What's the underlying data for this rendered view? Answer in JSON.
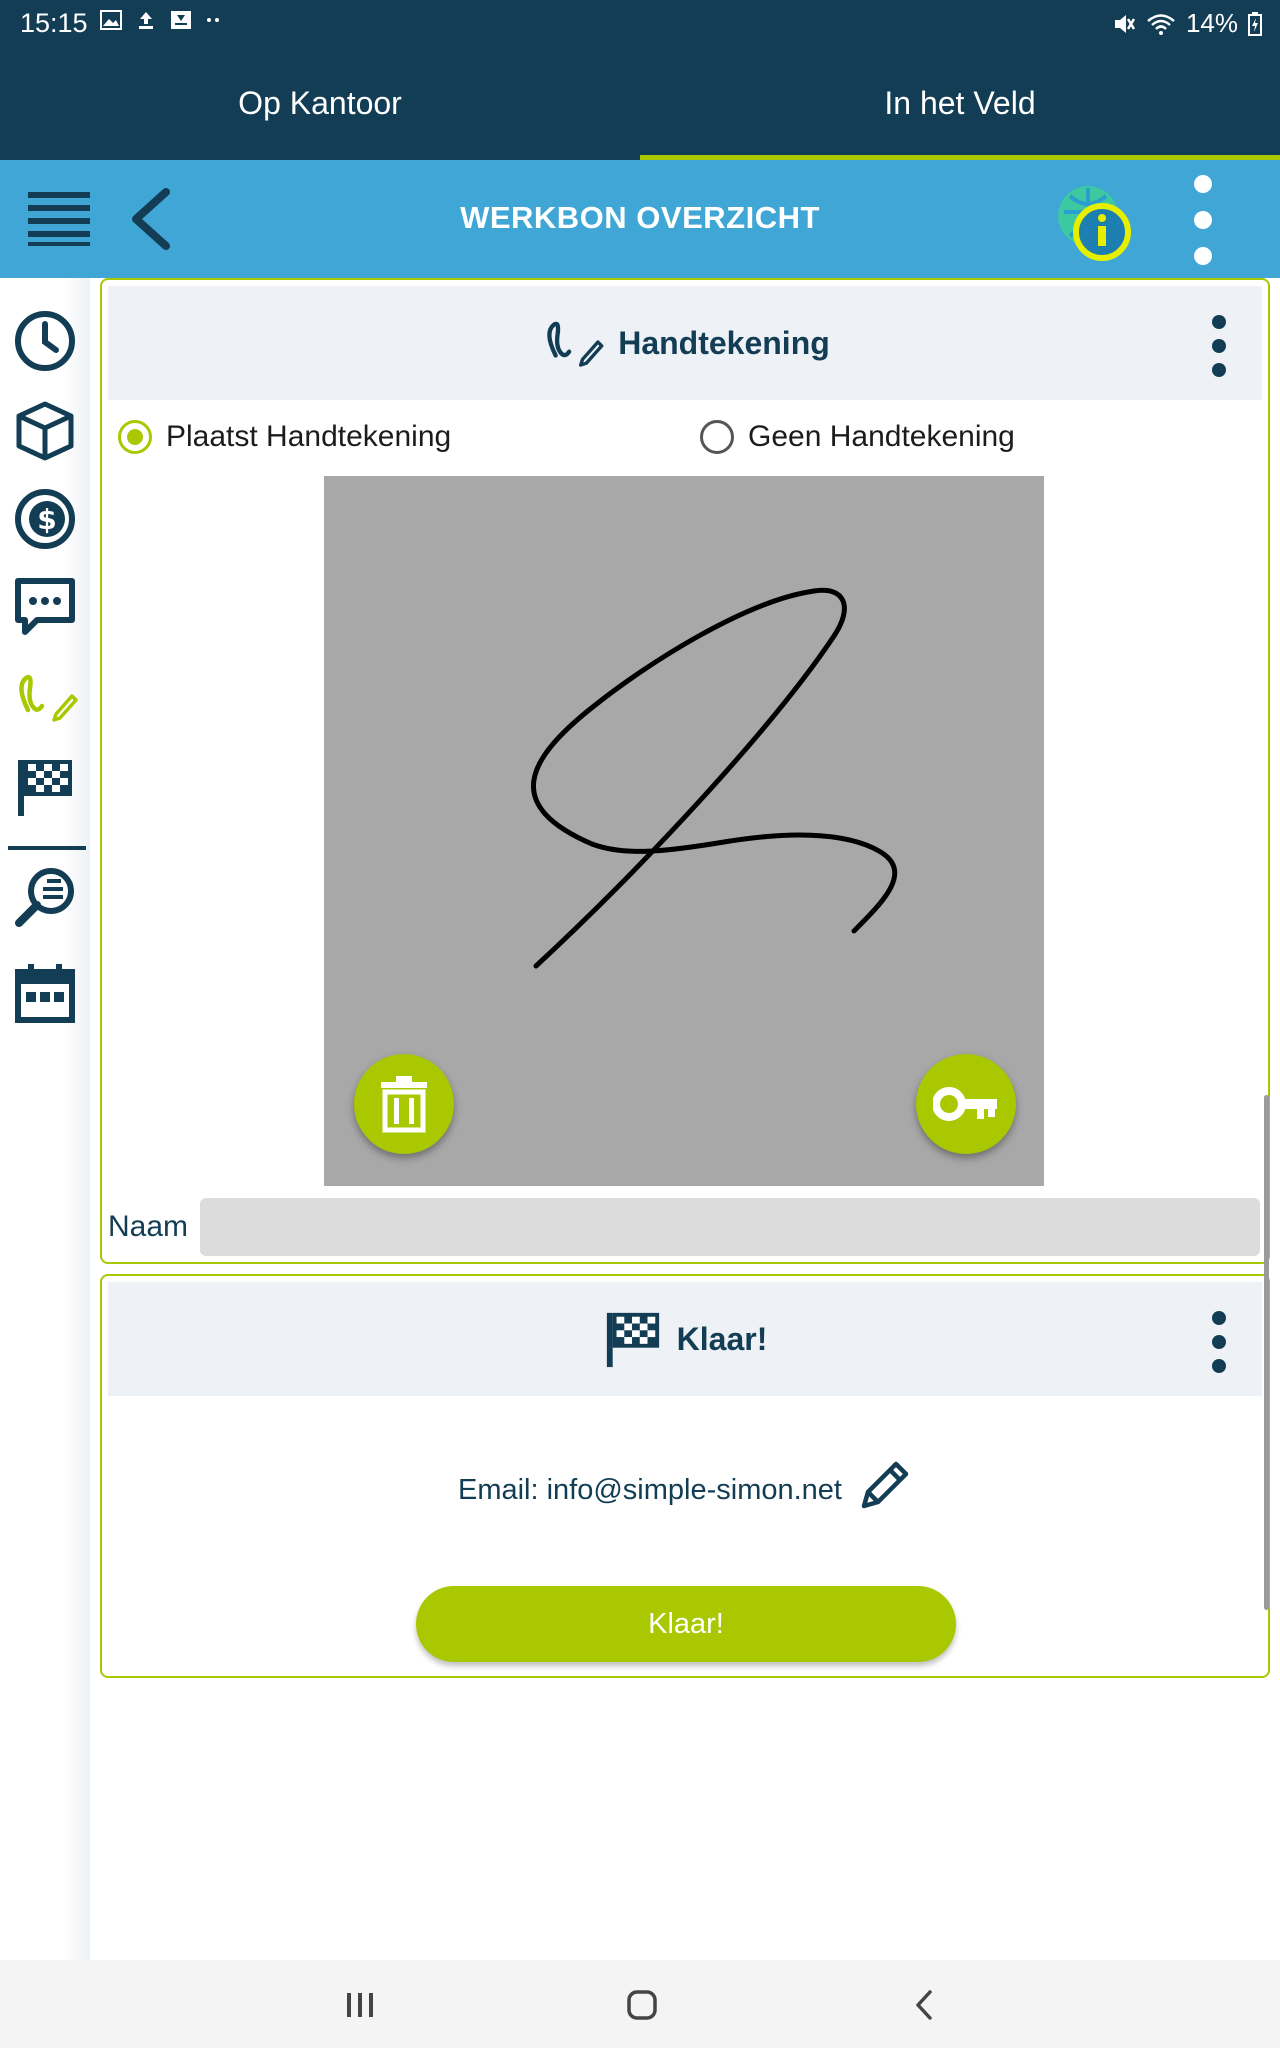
{
  "status_bar": {
    "time": "15:15",
    "battery": "14%"
  },
  "tabs": [
    {
      "label": "Op Kantoor",
      "active": false
    },
    {
      "label": "In het Veld",
      "active": true
    }
  ],
  "toolbar": {
    "title": "WERKBON OVERZICHT",
    "menu_icon": "hamburger-icon",
    "back_icon": "chevron-left-icon",
    "info_icon": "info-globe-icon",
    "more_icon": "more-vertical-icon"
  },
  "sidebar": {
    "items": [
      {
        "icon": "clock-icon"
      },
      {
        "icon": "box-icon"
      },
      {
        "icon": "dollar-icon"
      },
      {
        "icon": "chat-icon"
      },
      {
        "icon": "signature-icon",
        "active": true
      },
      {
        "icon": "finish-flag-icon"
      },
      {
        "icon": "search-list-icon"
      },
      {
        "icon": "calendar-icon"
      }
    ]
  },
  "signature_card": {
    "title": "Handtekening",
    "options": [
      {
        "label": "Plaatst Handtekening",
        "selected": true
      },
      {
        "label": "Geen Handtekening",
        "selected": false
      }
    ],
    "delete_icon": "trash-icon",
    "confirm_icon": "key-icon",
    "name_label": "Naam",
    "name_value": ""
  },
  "done_card": {
    "title": "Klaar!",
    "email_text": "Email: info@simple-simon.net",
    "edit_icon": "pencil-icon",
    "button_label": "Klaar!"
  },
  "colors": {
    "dark_blue": "#123d54",
    "toolbar_blue": "#3fa6d6",
    "accent_green": "#a9c800",
    "pad_gray": "#a8a8a8"
  }
}
